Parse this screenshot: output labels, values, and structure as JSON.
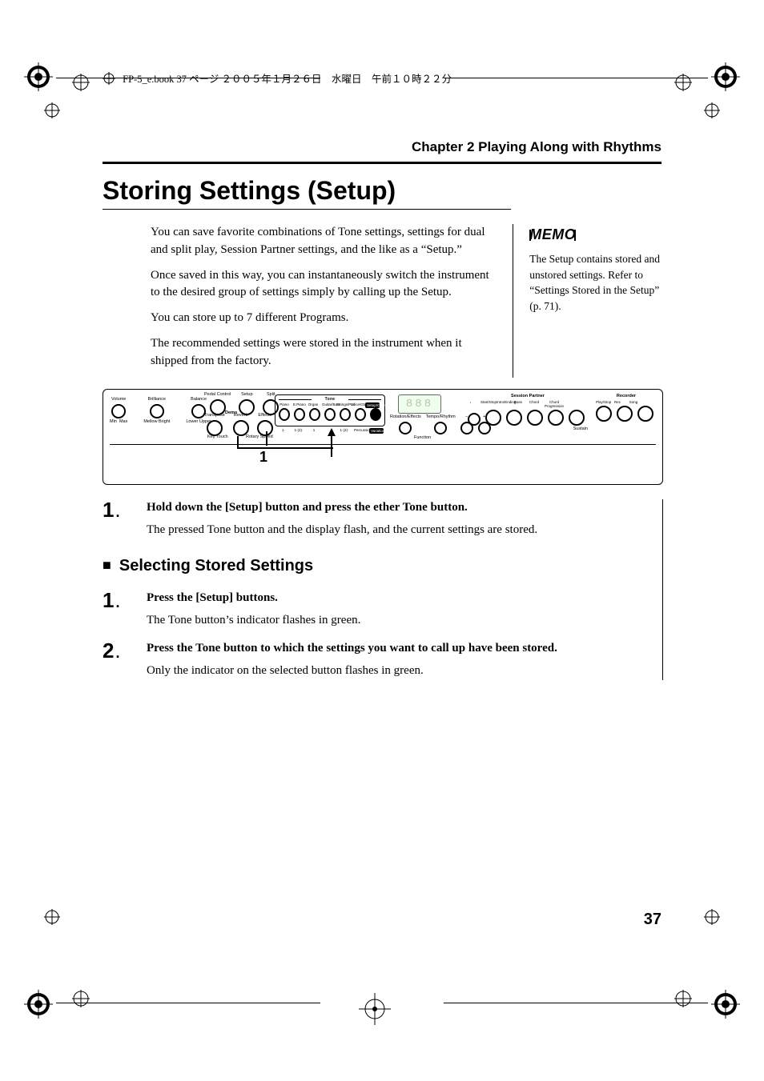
{
  "runhead": {
    "text": "FP-5_e.book  37 ページ  ２００５年１月２６日　水曜日　午前１０時２２分"
  },
  "chapter": {
    "label": "Chapter 2 Playing Along with Rhythms"
  },
  "title": "Storing Settings (Setup)",
  "intro": {
    "p1": "You can save favorite combinations of Tone settings, settings for dual and split play, Session Partner settings, and the like as a “Setup.”",
    "p2": "Once saved in this way, you can instantaneously switch the instrument to the desired group of settings simply by calling up the Setup.",
    "p3": "You can store up to 7 different Programs.",
    "p4": "The recommended settings were stored in the instrument when it shipped from the factory."
  },
  "memo": {
    "label": "MEMO",
    "body": "The Setup contains stored and unstored settings. Refer to “Settings Stored in the Setup” (p. 71)."
  },
  "panel": {
    "volume": "Volume",
    "brilliance": "Brilliance",
    "balance": "Balance",
    "vol_sub_left": "Min",
    "vol_sub_right": "Max",
    "bri_sub_left": "Mellow",
    "bri_sub_right": "Bright",
    "bal_sub_left": "Lower",
    "bal_sub_right": "Upper",
    "pedal": "Pedal Control",
    "setup": "Setup",
    "split": "Split",
    "transpose": "Transpose",
    "reverb": "Reverb",
    "effects": "Effects",
    "demo": "Demo",
    "keytouch": "Key Touch",
    "rotary": "Rotary Speed",
    "tone_group": "Tone",
    "tones": [
      "Piano",
      "E.Piano",
      "Organ",
      "Guitar/Bass",
      "Strings/Pad",
      "Voice/GM2",
      "Setup/Others"
    ],
    "tone_under": [
      "1·",
      "1·(2)·",
      "1",
      "·",
      "1·(2)·",
      "Percussion",
      "Variation"
    ],
    "rotation": "Rotation/Effects",
    "tempo": "Tempo/Rhythm",
    "minus": "−",
    "plus": "+",
    "function": "Function",
    "session_group": "Session Partner",
    "session_items": [
      "Start/Stop",
      "Intro/Ending",
      "Bass",
      "Chord",
      "Chord Progression"
    ],
    "recorder_group": "Recorder",
    "recorder_items": [
      "Play/Stop",
      "Rec",
      "Song"
    ],
    "sustain": "Sustain",
    "display_text": "888",
    "callout_label": "1"
  },
  "steps_a": {
    "s1": {
      "num": "1",
      "lead": "Hold down the [Setup] button and press the ether Tone button.",
      "body": "The pressed Tone button and the display flash, and the current settings are stored."
    }
  },
  "subhead": "Selecting Stored Settings",
  "steps_b": {
    "s1": {
      "num": "1",
      "lead": "Press the [Setup] buttons.",
      "body": "The Tone button’s indicator flashes in green."
    },
    "s2": {
      "num": "2",
      "lead": "Press the Tone button to which the settings you want to call up have been stored.",
      "body": "Only the indicator on the selected button flashes in green."
    }
  },
  "page_number": "37"
}
